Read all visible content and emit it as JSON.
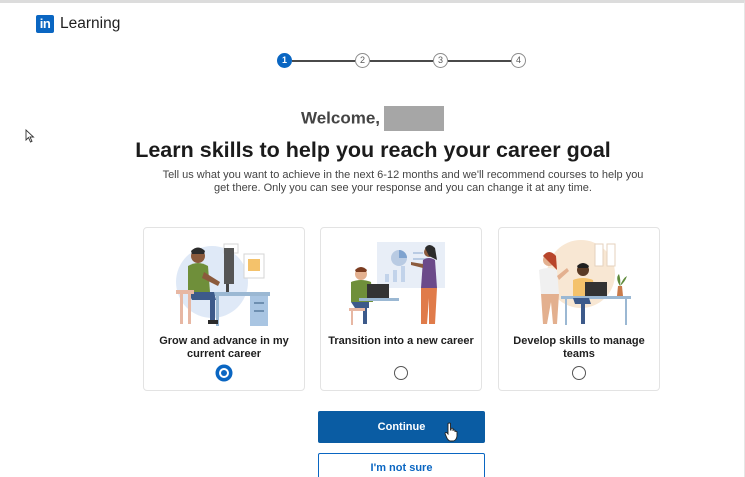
{
  "brand": {
    "logo_text": "in",
    "name": "Learning"
  },
  "stepper": {
    "steps": [
      "1",
      "2",
      "3",
      "4"
    ],
    "current": 1
  },
  "welcome": {
    "text": "Welcome,"
  },
  "headline": "Learn skills to help you reach your career goal",
  "subtext": "Tell us what you want to achieve in the next 6-12 months and we'll recommend courses to help you get there. Only you can see your response and you can change it at any time.",
  "options": [
    {
      "label": "Grow and advance in my current career",
      "selected": true
    },
    {
      "label": "Transition into a new career",
      "selected": false
    },
    {
      "label": "Develop skills to manage teams",
      "selected": false
    }
  ],
  "buttons": {
    "continue": "Continue",
    "not_sure": "I'm not sure"
  },
  "colors": {
    "accent": "#0a66c2",
    "continue_bg": "#0a5ca3",
    "redacted": "#a6a6a6"
  }
}
